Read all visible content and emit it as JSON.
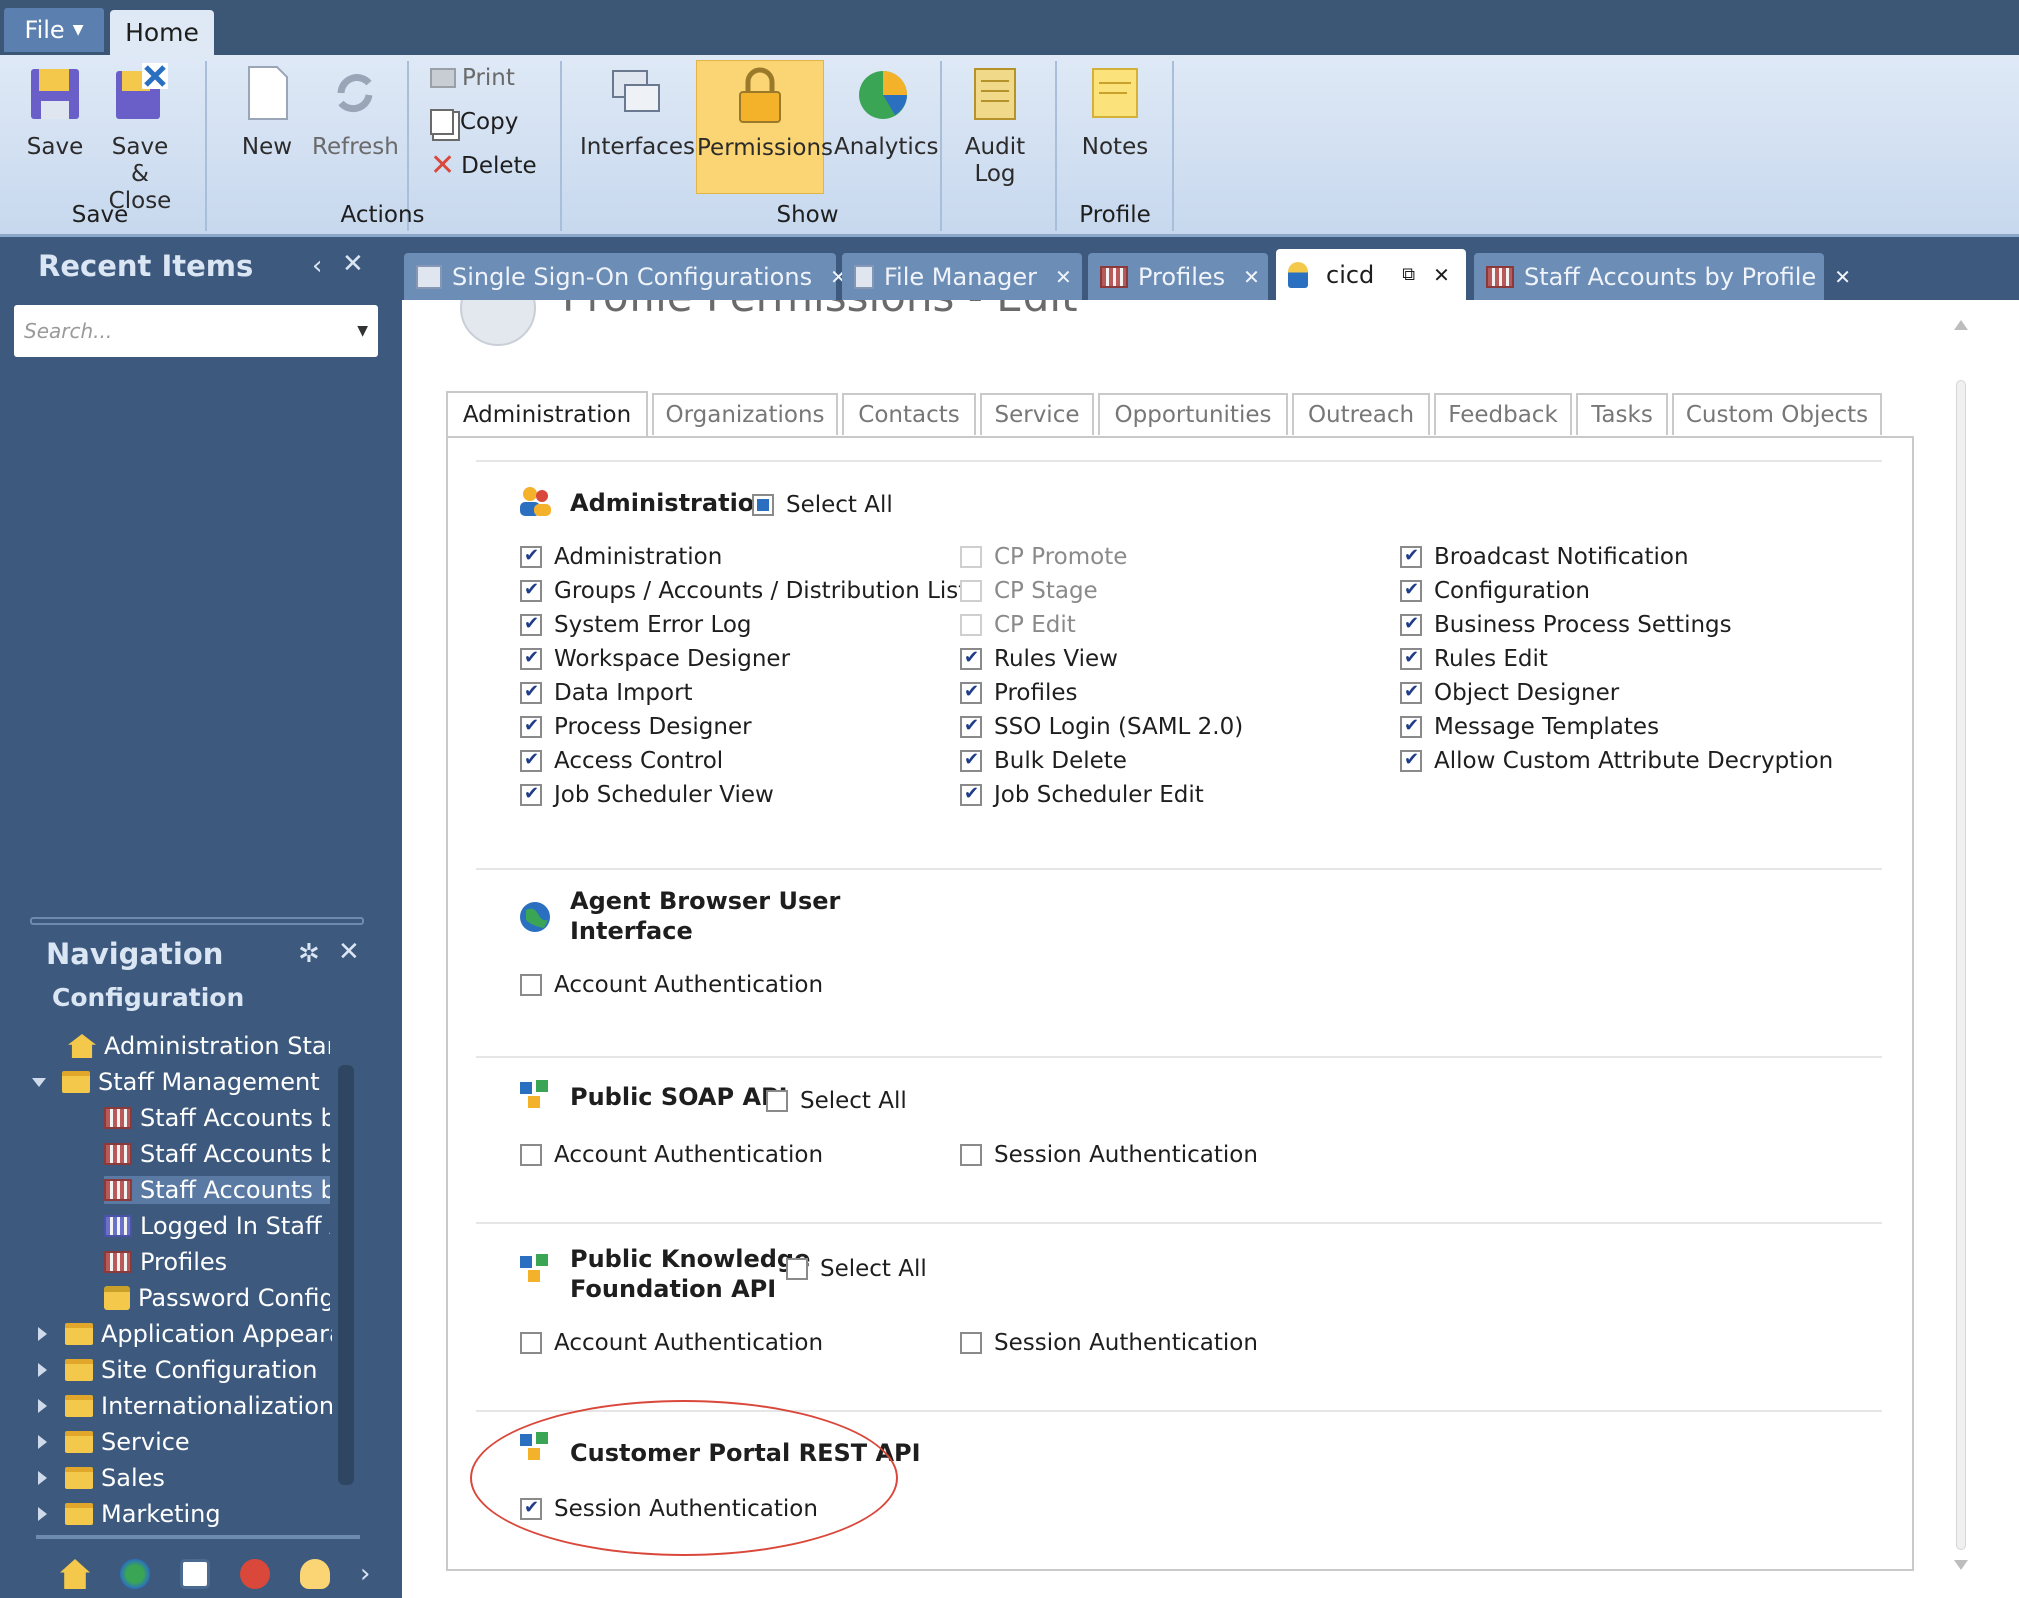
{
  "menubar": {
    "file": "File",
    "home": "Home"
  },
  "ribbon": {
    "save": "Save",
    "save_close_1": "Save &",
    "save_close_2": "Close",
    "new": "New",
    "refresh": "Refresh",
    "print": "Print",
    "copy": "Copy",
    "delete": "Delete",
    "interfaces": "Interfaces",
    "permissions": "Permissions",
    "analytics": "Analytics",
    "audit_1": "Audit",
    "audit_2": "Log",
    "notes": "Notes",
    "groups": {
      "save": "Save",
      "actions": "Actions",
      "show": "Show",
      "profile": "Profile"
    }
  },
  "sidebar": {
    "recent_title": "Recent Items",
    "search_placeholder": "Search...",
    "nav_title": "Navigation",
    "nav_section": "Configuration",
    "items": [
      "Administration Start P",
      "Staff Management",
      "Staff Accounts by",
      "Staff Accounts by",
      "Staff Accounts by",
      "Logged In Staff Ac",
      "Profiles",
      "Password Configu",
      "Application Appearan",
      "Site Configuration",
      "Internationalization",
      "Service",
      "Sales",
      "Marketing"
    ]
  },
  "doctabs": [
    "Single Sign-On Configurations",
    "File Manager",
    "Profiles",
    "cicd",
    "Staff Accounts by Profile"
  ],
  "content": {
    "title": "Profile Permissions - Edit",
    "tabs": [
      "Administration",
      "Organizations",
      "Contacts",
      "Service",
      "Opportunities",
      "Outreach",
      "Feedback",
      "Tasks",
      "Custom Objects"
    ],
    "admin": {
      "title": "Administration",
      "select_all": "Select All",
      "col1": [
        "Administration",
        "Groups / Accounts / Distribution Lists",
        "System Error Log",
        "Workspace Designer",
        "Data Import",
        "Process Designer",
        "Access Control",
        "Job Scheduler View"
      ],
      "col2": [
        "CP Promote",
        "CP Stage",
        "CP Edit",
        "Rules View",
        "Profiles",
        "SSO Login (SAML 2.0)",
        "Bulk Delete",
        "Job Scheduler Edit"
      ],
      "col3": [
        "Broadcast Notification",
        "Configuration",
        "Business Process Settings",
        "Rules Edit",
        "Object Designer",
        "Message Templates",
        "Allow Custom Attribute Decryption"
      ]
    },
    "agent": {
      "title_1": "Agent Browser User",
      "title_2": "Interface",
      "account_auth": "Account Authentication"
    },
    "soap": {
      "title": "Public SOAP API",
      "select_all": "Select All",
      "account_auth": "Account Authentication",
      "session_auth": "Session Authentication"
    },
    "kf": {
      "title_1": "Public Knowledge",
      "title_2": "Foundation API",
      "select_all": "Select All",
      "account_auth": "Account Authentication",
      "session_auth": "Session Authentication"
    },
    "rest": {
      "title": "Customer Portal REST API",
      "session_auth": "Session Authentication"
    }
  },
  "colors": {
    "sidebar": "#3d5a7e",
    "ribbon": "#dfe9f6",
    "active_button": "#fbd574",
    "highlight": "#d9483b"
  }
}
